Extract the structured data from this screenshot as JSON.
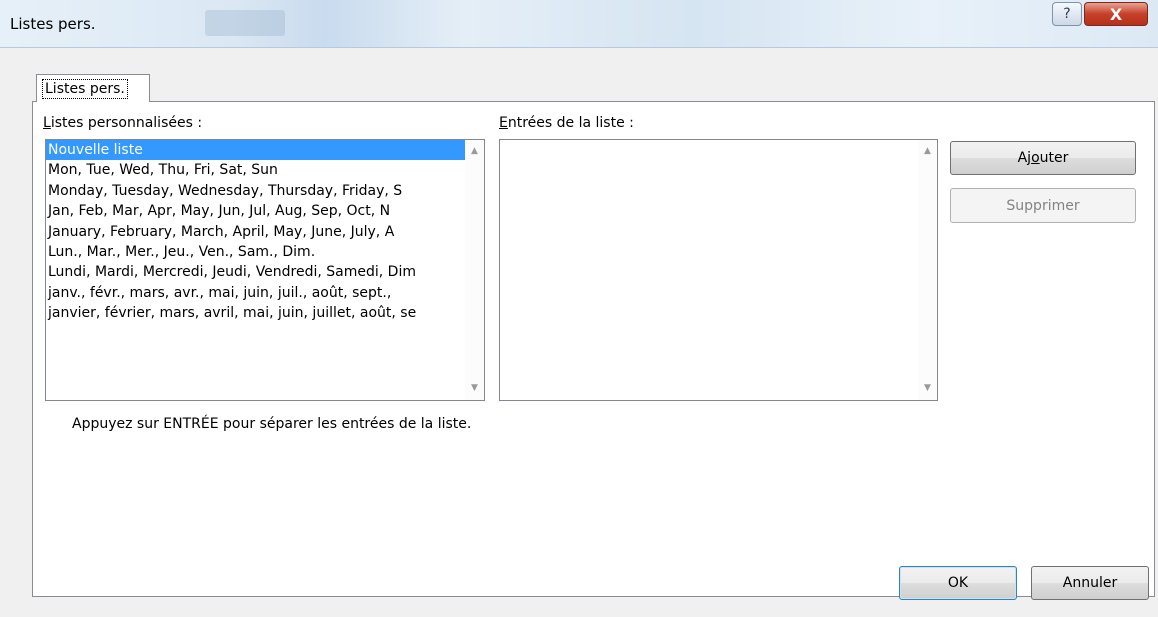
{
  "window": {
    "title": "Listes pers.",
    "help_icon": "help-question-icon",
    "close_icon": "close-x-icon",
    "help_glyph": "?",
    "close_glyph": "X"
  },
  "tab": {
    "label": "Listes pers."
  },
  "lists": {
    "label_first": "L",
    "label_rest": "istes personnalisées :",
    "items": [
      "Nouvelle liste",
      "Mon, Tue, Wed, Thu, Fri, Sat, Sun",
      "Monday, Tuesday, Wednesday, Thursday, Friday, S",
      "Jan, Feb, Mar, Apr, May, Jun, Jul, Aug, Sep, Oct, N",
      "January, February, March, April, May, June, July, A",
      "Lun., Mar., Mer., Jeu., Ven., Sam., Dim.",
      "Lundi, Mardi, Mercredi, Jeudi, Vendredi, Samedi, Dim",
      "janv., févr., mars, avr., mai, juin, juil., août, sept., ",
      "janvier, février, mars, avril, mai, juin, juillet, août, se"
    ],
    "selected_index": 0
  },
  "entries": {
    "label_first": "E",
    "label_rest": "ntrées de la liste :",
    "value": ""
  },
  "buttons": {
    "add_pre": "Aj",
    "add_key": "o",
    "add_post": "uter",
    "delete": "Supprimer",
    "ok": "OK",
    "cancel": "Annuler"
  },
  "hint": "Appuyez sur ENTRÉE pour séparer les entrées de la liste.",
  "colors": {
    "selection": "#3399ff",
    "close_button": "#c6402a",
    "disabled_text": "#838383"
  }
}
